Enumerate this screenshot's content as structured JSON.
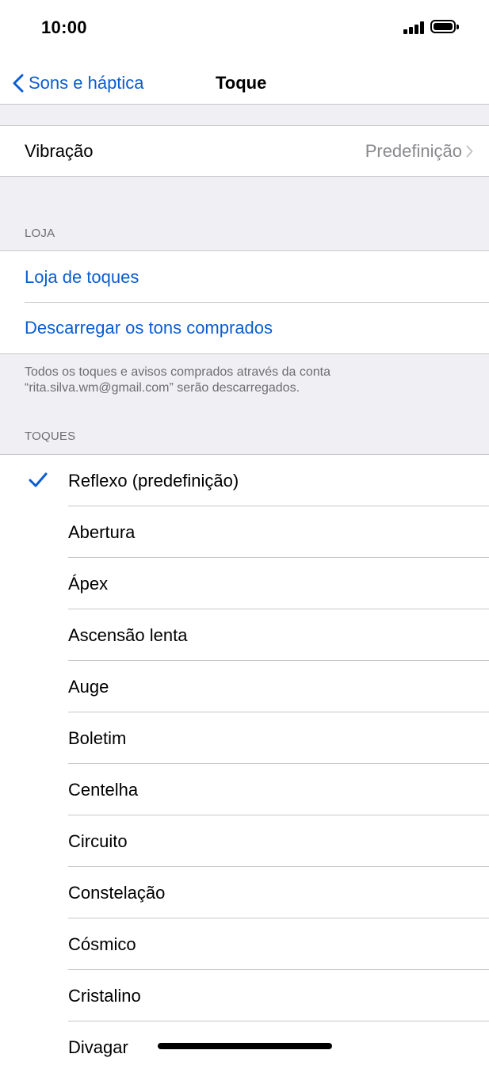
{
  "status": {
    "time": "10:00"
  },
  "nav": {
    "back_label": "Sons e háptica",
    "title": "Toque"
  },
  "vibration": {
    "label": "Vibração",
    "value": "Predefinição"
  },
  "store": {
    "header": "LOJA",
    "items": [
      "Loja de toques",
      "Descarregar os tons comprados"
    ],
    "footer": "Todos os toques e avisos comprados através da conta “rita.silva.wm@gmail.com” serão descarregados."
  },
  "ringtones": {
    "header": "TOQUES",
    "selected_index": 0,
    "items": [
      "Reflexo (predefinição)",
      "Abertura",
      "Ápex",
      "Ascensão lenta",
      "Auge",
      "Boletim",
      "Centelha",
      "Circuito",
      "Constelação",
      "Cósmico",
      "Cristalino",
      "Divagar"
    ]
  },
  "colors": {
    "accent": "#0a5dd2",
    "background": "#efeff4",
    "separator": "#c8c7cc",
    "secondary_text": "#6d6d72"
  }
}
